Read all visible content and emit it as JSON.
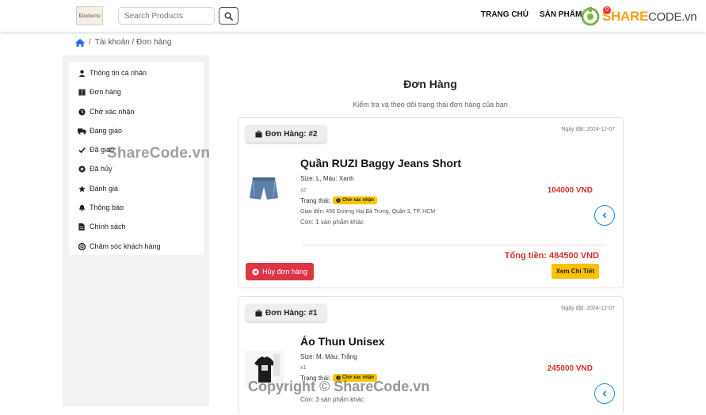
{
  "header": {
    "logo_text": "Kimberie",
    "search_placeholder": "Search Products",
    "nav": {
      "home": "TRANG CHỦ",
      "products": "SẢN PHẨM"
    },
    "cart_count": "0",
    "watermark_logo": {
      "main": "SHARE",
      "suffix": "CODE.vn"
    }
  },
  "breadcrumb": {
    "text": "Tài khoản / Đơn hàng"
  },
  "sidebar": {
    "items": [
      {
        "label": "Thông tin cá nhân",
        "icon": "user-icon"
      },
      {
        "label": "Đơn hàng",
        "icon": "box-icon"
      },
      {
        "label": "Chờ xác nhận",
        "icon": "clock-icon"
      },
      {
        "label": "Đang giao",
        "icon": "truck-icon"
      },
      {
        "label": "Đã giao",
        "icon": "check-icon"
      },
      {
        "label": "Đã hủy",
        "icon": "cancel-circle-icon"
      },
      {
        "label": "Đánh giá",
        "icon": "star-icon"
      },
      {
        "label": "Thông báo",
        "icon": "bell-icon"
      },
      {
        "label": "Chính sách",
        "icon": "document-icon"
      },
      {
        "label": "Chăm sóc khách hàng",
        "icon": "support-icon"
      }
    ]
  },
  "main": {
    "title": "Đơn Hàng",
    "subtitle": "Kiểm tra và theo dõi trạng thái đơn hàng của bạn",
    "status_label": "Trạng thái:",
    "orders": [
      {
        "tag": "Đơn Hàng: #2",
        "date": "Ngày đặt: 2024-12-07",
        "product_name": "Quần RUZI Baggy Jeans Short",
        "meta": "Size: L, Màu: Xanh",
        "qty": "x2",
        "status": "Chờ xác nhận",
        "address": "Giao đến: 456 Đường Hai Bà Trưng, Quận 3, TP. HCM",
        "more": "Còn: 1 sản phẩm khác",
        "price": "104000 VND",
        "total": "Tổng tiền: 484500 VND",
        "cancel_label": "Hủy đơn hàng",
        "detail_label": "Xem Chi Tiết"
      },
      {
        "tag": "Đơn Hàng: #1",
        "date": "Ngày đặt: 2024-12-07",
        "product_name": "Áo Thun Unisex",
        "meta": "Size: M, Màu: Trắng",
        "qty": "x1",
        "status": "Chờ xác nhận",
        "more": "Còn: 3 sản phẩm khác",
        "price": "245000 VND"
      }
    ]
  },
  "watermarks": {
    "mid": "ShareCode.vn",
    "bottom": "Copyright © ShareCode.vn"
  },
  "colors": {
    "accent_blue": "#1e88e5",
    "danger": "#dc3545",
    "warning": "#ffc107",
    "price_red": "#d32f2f"
  }
}
